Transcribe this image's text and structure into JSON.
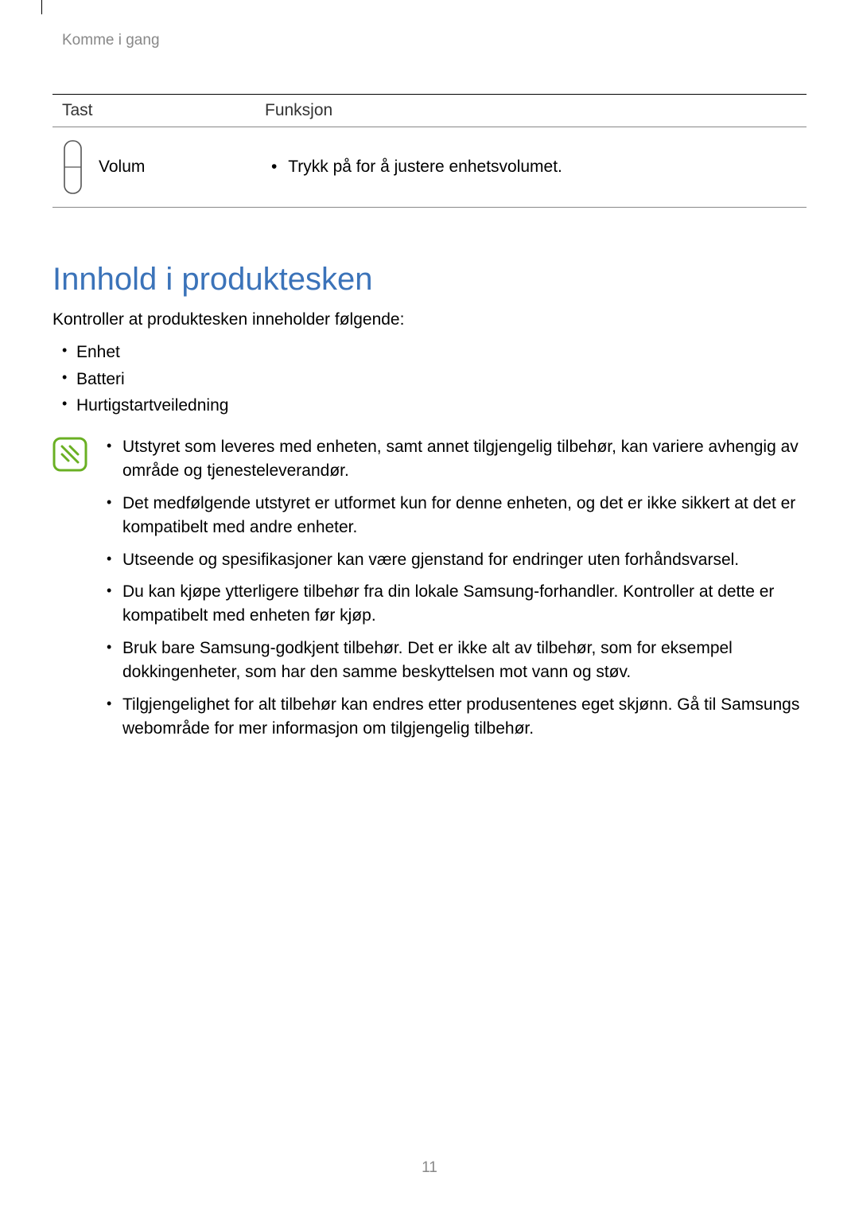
{
  "header": {
    "section": "Komme i gang"
  },
  "table": {
    "headers": {
      "key": "Tast",
      "function": "Funksjon"
    },
    "row": {
      "key_name": "Volum",
      "function_text": "Trykk på for å justere enhetsvolumet."
    }
  },
  "section": {
    "title": "Innhold i produktesken",
    "intro": "Kontroller at produktesken inneholder følgende:",
    "items": {
      "i0": "Enhet",
      "i1": "Batteri",
      "i2": "Hurtigstartveiledning"
    },
    "notes": {
      "n0": "Utstyret som leveres med enheten, samt annet tilgjengelig tilbehør, kan variere avhengig av område og tjenesteleverandør.",
      "n1": "Det medfølgende utstyret er utformet kun for denne enheten, og det er ikke sikkert at det er kompatibelt med andre enheter.",
      "n2": "Utseende og spesifikasjoner kan være gjenstand for endringer uten forhåndsvarsel.",
      "n3": "Du kan kjøpe ytterligere tilbehør fra din lokale Samsung-forhandler. Kontroller at dette er kompatibelt med enheten før kjøp.",
      "n4": "Bruk bare Samsung-godkjent tilbehør. Det er ikke alt av tilbehør, som for eksempel dokkingenheter, som har den samme beskyttelsen mot vann og støv.",
      "n5": "Tilgjengelighet for alt tilbehør kan endres etter produsentenes eget skjønn. Gå til Samsungs webområde for mer informasjon om tilgjengelig tilbehør."
    }
  },
  "page_number": "11"
}
